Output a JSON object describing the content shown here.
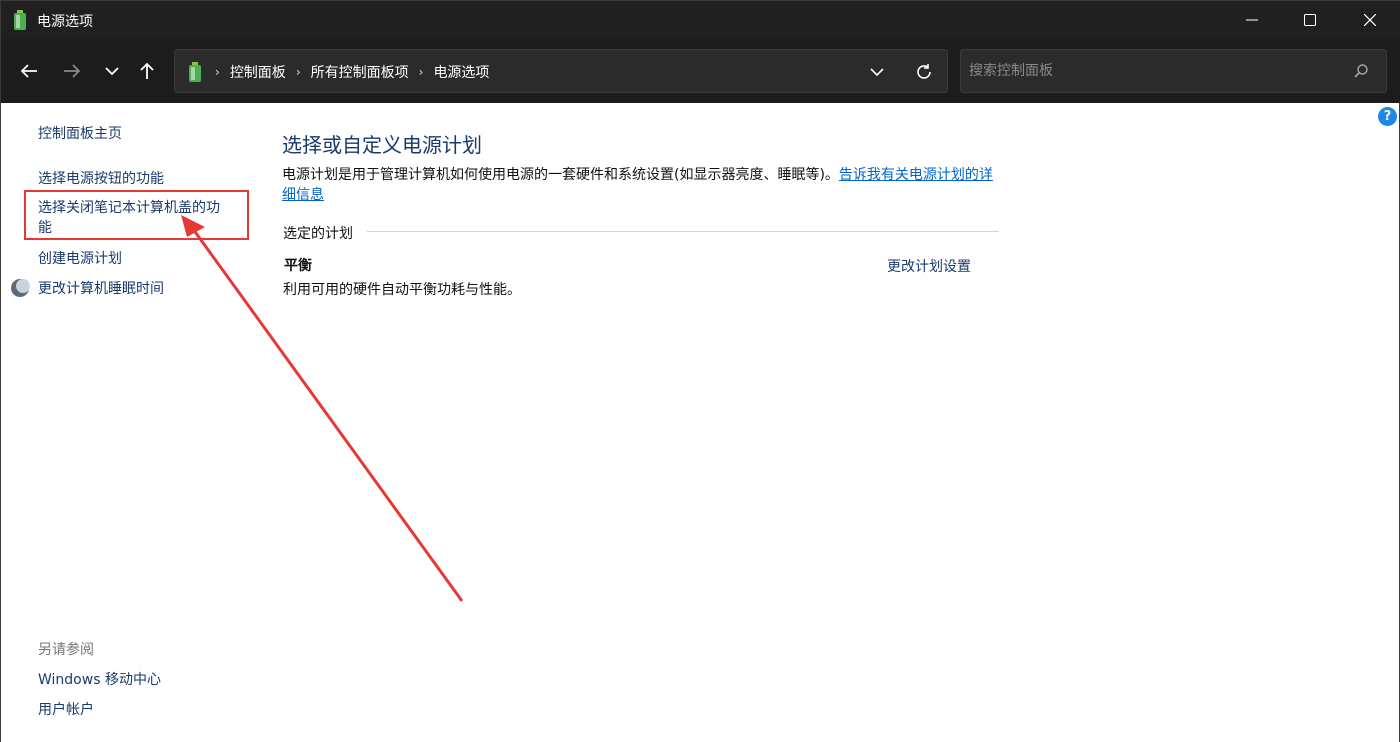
{
  "window": {
    "title": "电源选项"
  },
  "navbar": {
    "breadcrumbs": [
      "控制面板",
      "所有控制面板项",
      "电源选项"
    ],
    "search_placeholder": "搜索控制面板"
  },
  "sidebar": {
    "home_link": "控制面板主页",
    "tasks": [
      {
        "label": "选择电源按钮的功能"
      },
      {
        "label": "选择关闭笔记本计算机盖的功",
        "label_line2": "能"
      },
      {
        "label": "创建电源计划"
      },
      {
        "label": "更改计算机睡眠时间"
      }
    ],
    "see_also_title": "另请参阅",
    "see_also": [
      "Windows 移动中心",
      "用户帐户"
    ]
  },
  "main": {
    "title": "选择或自定义电源计划",
    "description": "电源计划是用于管理计算机如何使用电源的一套硬件和系统设置(如显示器亮度、睡眠等)。",
    "description_link": "告诉我有关电源计划的详细信息",
    "section_title": "选定的计划",
    "plan": {
      "name": "平衡",
      "description": "利用可用的硬件自动平衡功耗与性能。",
      "settings_link": "更改计划设置"
    }
  },
  "colors": {
    "titlebar_bg": "#202020",
    "link": "#1a3a6e",
    "annotation": "#e53935"
  },
  "icons": [
    "battery-icon",
    "back-arrow-icon",
    "forward-arrow-icon",
    "history-chevron-icon",
    "up-arrow-icon",
    "chevron-down-icon",
    "refresh-icon",
    "search-icon",
    "help-icon",
    "moon-icon",
    "minimize-icon",
    "maximize-icon",
    "close-icon"
  ]
}
